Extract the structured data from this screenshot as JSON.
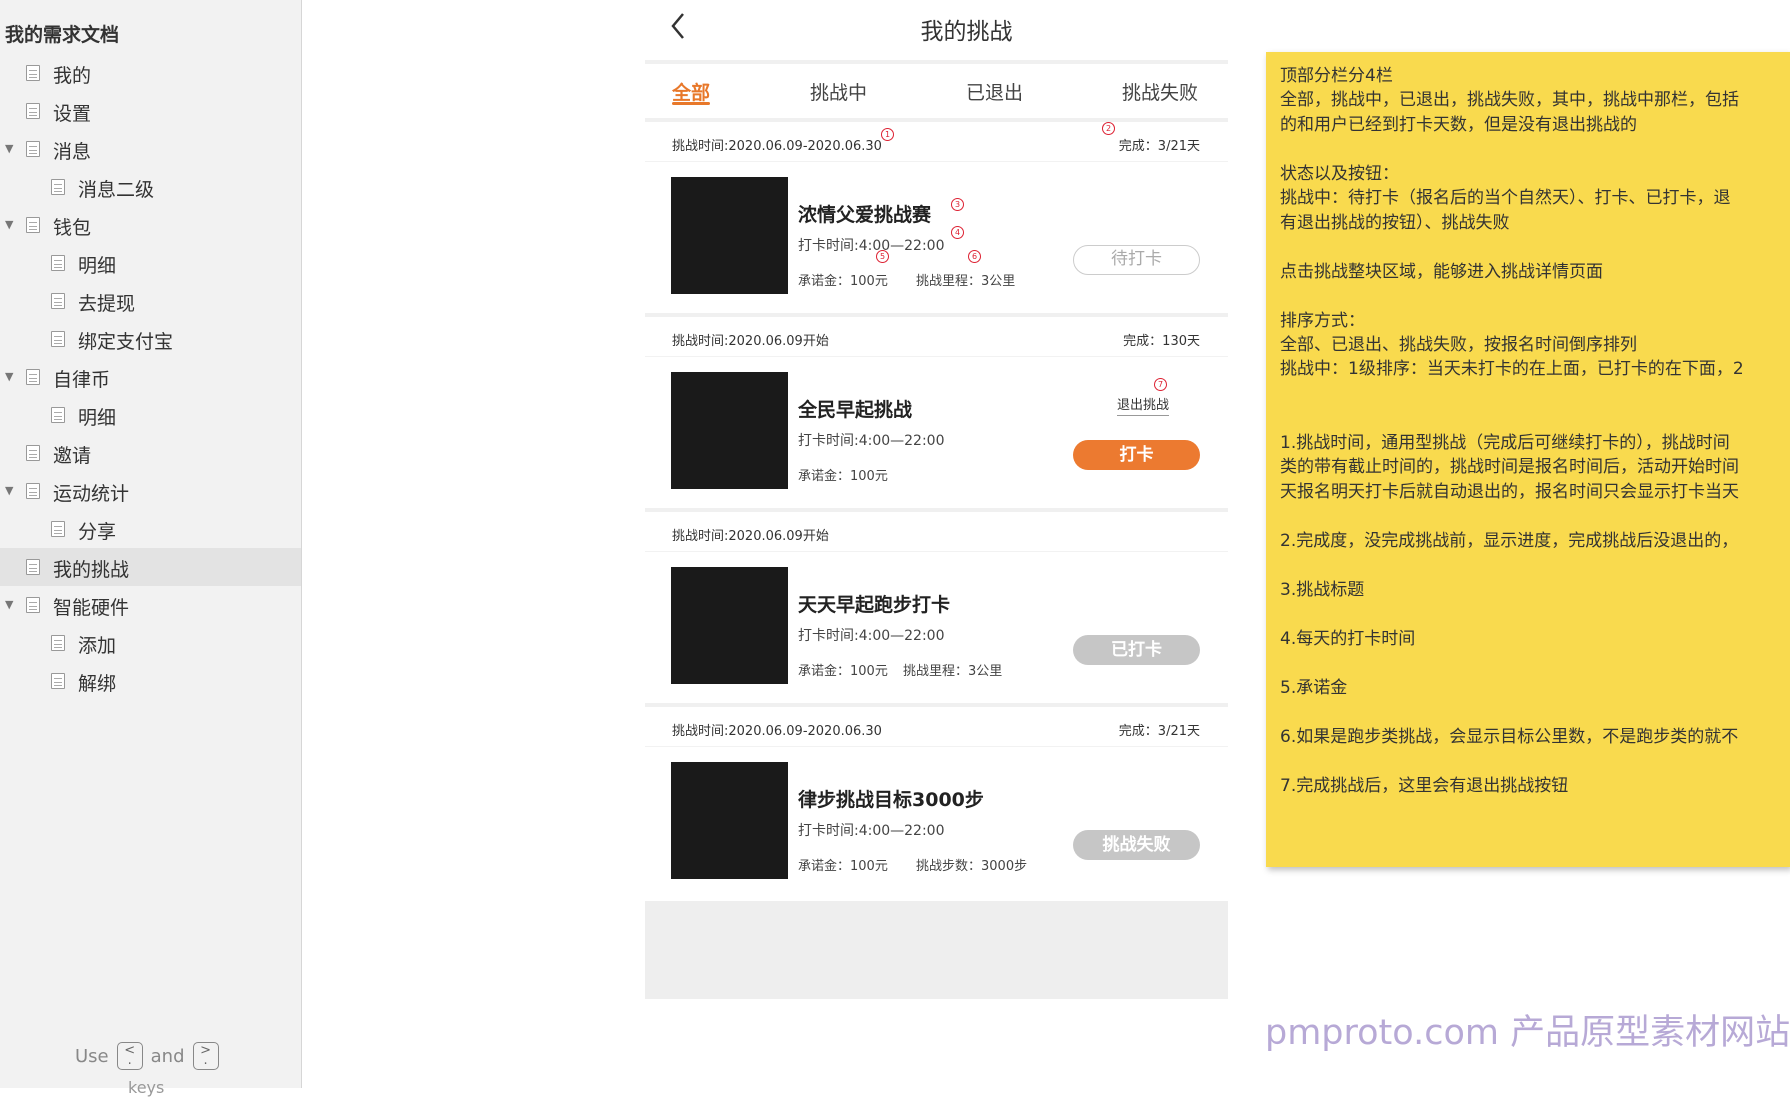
{
  "sidebar": {
    "title": "我的需求文档",
    "items": [
      {
        "label": "我的",
        "level": 0,
        "expanded": false,
        "has_children": false
      },
      {
        "label": "设置",
        "level": 0,
        "expanded": false,
        "has_children": false
      },
      {
        "label": "消息",
        "level": 0,
        "expanded": true,
        "has_children": true
      },
      {
        "label": "消息二级",
        "level": 1,
        "expanded": false,
        "has_children": false
      },
      {
        "label": "钱包",
        "level": 0,
        "expanded": true,
        "has_children": true
      },
      {
        "label": "明细",
        "level": 1,
        "expanded": false,
        "has_children": false
      },
      {
        "label": "去提现",
        "level": 1,
        "expanded": false,
        "has_children": false
      },
      {
        "label": "绑定支付宝",
        "level": 1,
        "expanded": false,
        "has_children": false
      },
      {
        "label": "自律币",
        "level": 0,
        "expanded": true,
        "has_children": true
      },
      {
        "label": "明细",
        "level": 1,
        "expanded": false,
        "has_children": false
      },
      {
        "label": "邀请",
        "level": 0,
        "expanded": false,
        "has_children": false
      },
      {
        "label": "运动统计",
        "level": 0,
        "expanded": true,
        "has_children": true
      },
      {
        "label": "分享",
        "level": 1,
        "expanded": false,
        "has_children": false
      },
      {
        "label": "我的挑战",
        "level": 0,
        "expanded": false,
        "has_children": false,
        "selected": true
      },
      {
        "label": "智能硬件",
        "level": 0,
        "expanded": true,
        "has_children": true
      },
      {
        "label": "添加",
        "level": 1,
        "expanded": false,
        "has_children": false
      },
      {
        "label": "解绑",
        "level": 1,
        "expanded": false,
        "has_children": false
      }
    ],
    "footer": {
      "use": "Use",
      "and": "and",
      "key_prev": "<\n·",
      "key_next": ">\n·",
      "keys_text": "keys"
    }
  },
  "phone": {
    "title": "我的挑战",
    "back_icon": "chevron-left-icon",
    "tabs": [
      "全部",
      "挑战中",
      "已退出",
      "挑战失败"
    ],
    "active_tab": 0,
    "cards": [
      {
        "time": "挑战时间:2020.06.09-2020.06.30",
        "done": "完成：3/21天",
        "title": "浓情父爱挑战赛",
        "checkin_time": "打卡时间:4:00—22:00",
        "money": "承诺金：100元",
        "extra": "挑战里程：3公里",
        "button": "待打卡",
        "button_style": "wait",
        "quit": ""
      },
      {
        "time": "挑战时间:2020.06.09开始",
        "done": "完成：130天",
        "title": "全民早起挑战",
        "checkin_time": "打卡时间:4:00—22:00",
        "money": "承诺金：100元",
        "extra": "",
        "button": "打卡",
        "button_style": "checkin",
        "quit": "退出挑战"
      },
      {
        "time": "挑战时间:2020.06.09开始",
        "done": "",
        "title": "天天早起跑步打卡",
        "checkin_time": "打卡时间:4:00—22:00",
        "money": "承诺金：100元",
        "extra": "挑战里程：3公里",
        "button": "已打卡",
        "button_style": "done",
        "quit": ""
      },
      {
        "time": "挑战时间:2020.06.09-2020.06.30",
        "done": "完成：3/21天",
        "title": "律步挑战目标3000步",
        "checkin_time": "打卡时间:4:00—22:00",
        "money": "承诺金：100元",
        "extra": "挑战步数：3000步",
        "button": "挑战失败",
        "button_style": "fail",
        "quit": ""
      }
    ],
    "markers": [
      "1",
      "2",
      "3",
      "4",
      "5",
      "6",
      "7"
    ]
  },
  "note": {
    "lines": [
      "顶部分栏分4栏",
      "全部，挑战中，已退出，挑战失败，其中，挑战中那栏，包括",
      "的和用户已经到打卡天数，但是没有退出挑战的",
      "",
      "状态以及按钮：",
      "挑战中：待打卡（报名后的当个自然天）、打卡、已打卡，退",
      "有退出挑战的按钮）、挑战失败",
      "",
      "点击挑战整块区域，能够进入挑战详情页面",
      "",
      "排序方式：",
      "全部、已退出、挑战失败，按报名时间倒序排列",
      "挑战中：1级排序：当天未打卡的在上面，已打卡的在下面，2",
      "",
      "",
      "1.挑战时间，通用型挑战（完成后可继续打卡的），挑战时间",
      "类的带有截止时间的，挑战时间是报名时间后，活动开始时间",
      "天报名明天打卡后就自动退出的，报名时间只会显示打卡当天",
      "",
      "2.完成度，没完成挑战前，显示进度，完成挑战后没退出的，",
      "",
      "3.挑战标题",
      "",
      "4.每天的打卡时间",
      "",
      "5.承诺金",
      "",
      "6.如果是跑步类挑战，会显示目标公里数，不是跑步类的就不",
      "",
      "7.完成挑战后，这里会有退出挑战按钮"
    ]
  },
  "watermark": "pmproto.com 产品原型素材网站",
  "colors": {
    "accent": "#ec7a30",
    "note_bg": "#f9da4e",
    "marker": "#dd2233"
  }
}
